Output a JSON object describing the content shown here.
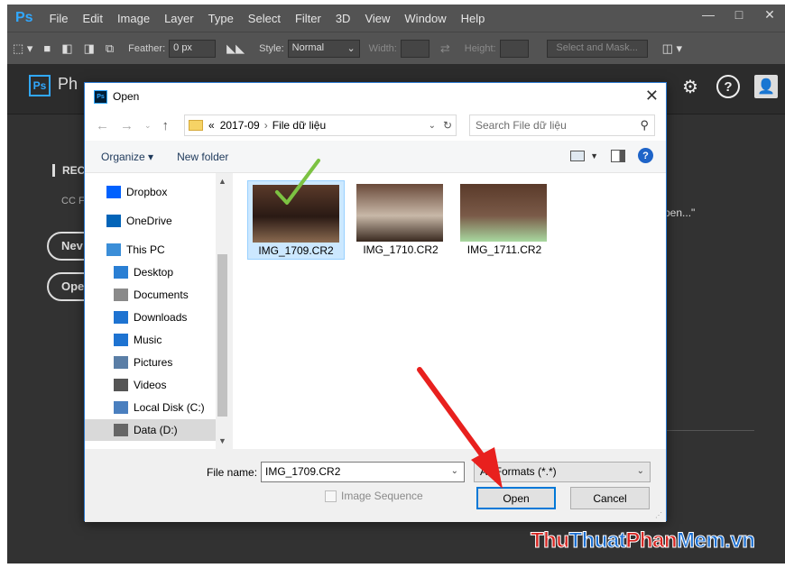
{
  "app": {
    "logo": "Ps",
    "menu": [
      "File",
      "Edit",
      "Image",
      "Layer",
      "Type",
      "Select",
      "Filter",
      "3D",
      "View",
      "Window",
      "Help"
    ],
    "window_controls": [
      "—",
      "□",
      "✕"
    ]
  },
  "options_bar": {
    "feather_label": "Feather:",
    "feather_value": "0 px",
    "style_label": "Style:",
    "style_value": "Normal",
    "width_label": "Width:",
    "height_label": "Height:",
    "select_mask_label": "Select and Mask..."
  },
  "home": {
    "logo": "Ps",
    "title": "Ph",
    "recent_label": "REC",
    "recent_sub": "CC F",
    "new_button": "Nev",
    "open_button": "Ope",
    "open_hint": "pen...\""
  },
  "dialog": {
    "icon_text": "Ps",
    "title": "Open",
    "close": "✕",
    "breadcrumb_prefix": "«",
    "breadcrumb": [
      "2017-09",
      "File dữ liệu"
    ],
    "search_placeholder": "Search File dữ liệu",
    "organize_label": "Organize ▾",
    "new_folder_label": "New folder",
    "nav_items": [
      {
        "label": "Dropbox",
        "icon": "dropbox-icon",
        "color": "#0061fe"
      },
      {
        "label": "OneDrive",
        "icon": "onedrive-icon",
        "color": "#0364b8"
      },
      {
        "label": "This PC",
        "icon": "computer-icon",
        "color": "#3b8ed8"
      },
      {
        "label": "Desktop",
        "icon": "desktop-icon",
        "color": "#2a7fd4"
      },
      {
        "label": "Documents",
        "icon": "documents-icon",
        "color": "#8a8a8a"
      },
      {
        "label": "Downloads",
        "icon": "downloads-icon",
        "color": "#1e73d1"
      },
      {
        "label": "Music",
        "icon": "music-icon",
        "color": "#1e73d1"
      },
      {
        "label": "Pictures",
        "icon": "pictures-icon",
        "color": "#5a7ea6"
      },
      {
        "label": "Videos",
        "icon": "videos-icon",
        "color": "#555555"
      },
      {
        "label": "Local Disk (C:)",
        "icon": "local-disk-icon",
        "color": "#4a7fbf"
      },
      {
        "label": "Data (D:)",
        "icon": "drive-icon",
        "color": "#666666"
      }
    ],
    "files": [
      {
        "name": "IMG_1709.CR2",
        "selected": true
      },
      {
        "name": "IMG_1710.CR2",
        "selected": false
      },
      {
        "name": "IMG_1711.CR2",
        "selected": false
      }
    ],
    "file_name_label": "File name:",
    "file_name_value": "IMG_1709.CR2",
    "file_type_value": "All Formats (*.*)",
    "image_sequence_label": "Image Sequence",
    "open_button": "Open",
    "cancel_button": "Cancel"
  },
  "watermark": {
    "part1": "Thu",
    "part2": "Thuat",
    "part3": "Phan",
    "part4": "Mem.vn"
  },
  "colors": {
    "accent_arrow": "#e8201e",
    "check": "#7cc242",
    "dialog_border": "#2b79d0",
    "ps_blue": "#31a8ff"
  }
}
